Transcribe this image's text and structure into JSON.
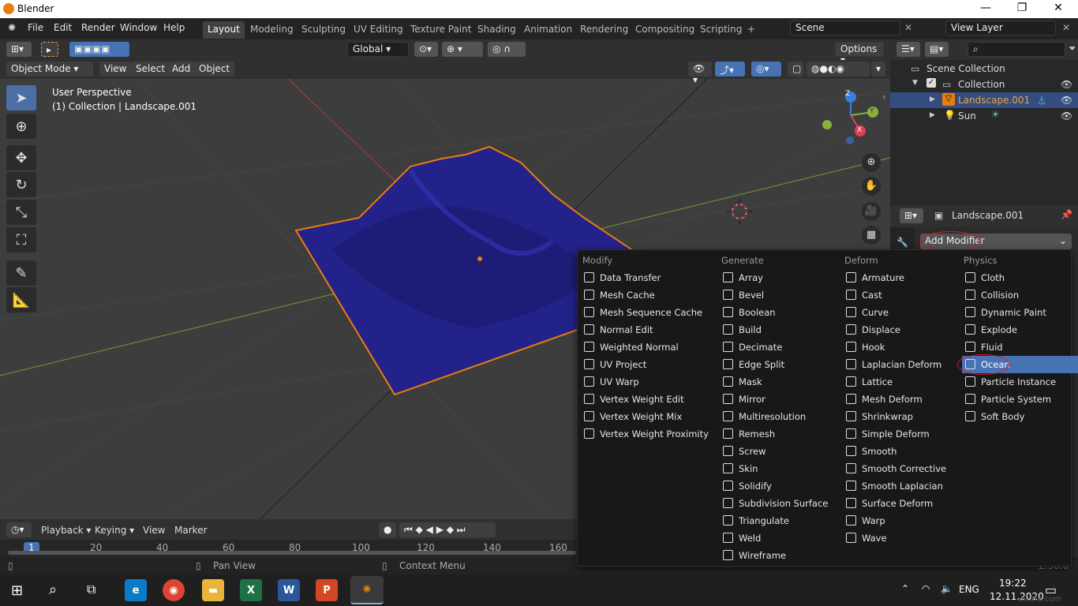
{
  "titlebar": {
    "title": "Blender",
    "min": "—",
    "max": "❐",
    "close": "✕"
  },
  "menubar": {
    "items": [
      "File",
      "Edit",
      "Render",
      "Window",
      "Help"
    ],
    "workspaces": [
      "Layout",
      "Modeling",
      "Sculpting",
      "UV Editing",
      "Texture Paint",
      "Shading",
      "Animation",
      "Rendering",
      "Compositing",
      "Scripting"
    ],
    "plus": "+",
    "scene": "Scene",
    "viewlayer": "View Layer"
  },
  "header3d": {
    "orientation": "Global",
    "options": "Options"
  },
  "header3d2": {
    "mode": "Object Mode",
    "view": "View",
    "select": "Select",
    "add": "Add",
    "object": "Object"
  },
  "viewport": {
    "line1": "User Perspective",
    "line2": "(1) Collection | Landscape.001",
    "gizmo": {
      "x": "X",
      "y": "Y",
      "z": "Z"
    }
  },
  "outliner": {
    "scene_collection": "Scene Collection",
    "collection": "Collection",
    "landscape": "Landscape.001",
    "sun": "Sun"
  },
  "properties": {
    "object_name": "Landscape.001",
    "add_modifier": "Add Modifier"
  },
  "menu": {
    "columns": [
      {
        "title": "Modify",
        "items": [
          "Data Transfer",
          "Mesh Cache",
          "Mesh Sequence Cache",
          "Normal Edit",
          "Weighted Normal",
          "UV Project",
          "UV Warp",
          "Vertex Weight Edit",
          "Vertex Weight Mix",
          "Vertex Weight Proximity"
        ]
      },
      {
        "title": "Generate",
        "items": [
          "Array",
          "Bevel",
          "Boolean",
          "Build",
          "Decimate",
          "Edge Split",
          "Mask",
          "Mirror",
          "Multiresolution",
          "Remesh",
          "Screw",
          "Skin",
          "Solidify",
          "Subdivision Surface",
          "Triangulate",
          "Weld",
          "Wireframe"
        ]
      },
      {
        "title": "Deform",
        "items": [
          "Armature",
          "Cast",
          "Curve",
          "Displace",
          "Hook",
          "Laplacian Deform",
          "Lattice",
          "Mesh Deform",
          "Shrinkwrap",
          "Simple Deform",
          "Smooth",
          "Smooth Corrective",
          "Smooth Laplacian",
          "Surface Deform",
          "Warp",
          "Wave"
        ]
      },
      {
        "title": "Physics",
        "items": [
          "Cloth",
          "Collision",
          "Dynamic Paint",
          "Explode",
          "Fluid",
          "Ocean",
          "Particle Instance",
          "Particle System",
          "Soft Body"
        ]
      }
    ],
    "highlighted": "Ocean"
  },
  "timeline": {
    "playback": "Playback",
    "keying": "Keying",
    "view": "View",
    "marker": "Marker",
    "frames": [
      "1",
      "20",
      "40",
      "60",
      "80",
      "100",
      "120",
      "140",
      "160"
    ]
  },
  "statusbar": {
    "pan": "Pan View",
    "context": "Context Menu",
    "version": "2.90.0"
  },
  "taskbar": {
    "lang": "ENG",
    "time": "19:22",
    "date": "12.11.2020",
    "watermark": "ulkafa.com"
  },
  "colors": {
    "accent": "#4772b3",
    "landscape": "#22228a",
    "outline": "#e87d0d",
    "red_annotation": "#e0191a"
  }
}
